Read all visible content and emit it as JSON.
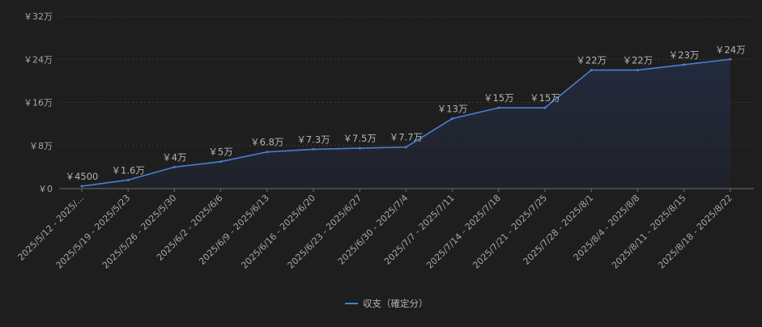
{
  "chart_data": {
    "type": "area",
    "categories": [
      "2025/5/12 - 2025/...",
      "2025/5/19 - 2025/5/23",
      "2025/5/26 - 2025/5/30",
      "2025/6/2 - 2025/6/6",
      "2025/6/9 - 2025/6/13",
      "2025/6/16 - 2025/6/20",
      "2025/6/23 - 2025/6/27",
      "2025/6/30 - 2025/7/4",
      "2025/7/7 - 2025/7/11",
      "2025/7/14 - 2025/7/18",
      "2025/7/21 - 2025/7/25",
      "2025/7/28 - 2025/8/1",
      "2025/8/4 - 2025/8/8",
      "2025/8/11 - 2025/8/15",
      "2025/8/18 - 2025/8/22"
    ],
    "series": [
      {
        "name": "収支（確定分）",
        "values": [
          4500,
          16000,
          40000,
          50000,
          68000,
          73000,
          75000,
          77000,
          130000,
          150000,
          150000,
          220000,
          220000,
          230000,
          240000
        ],
        "labels": [
          "￥4500",
          "￥1.6万",
          "￥4万",
          "￥5万",
          "￥6.8万",
          "￥7.3万",
          "￥7.5万",
          "￥7.7万",
          "￥13万",
          "￥15万",
          "￥15万",
          "￥22万",
          "￥22万",
          "￥23万",
          "￥24万"
        ]
      }
    ],
    "yticks": [
      0,
      80000,
      160000,
      240000,
      320000
    ],
    "ytick_labels": [
      "￥0",
      "￥8万",
      "￥16万",
      "￥24万",
      "￥32万"
    ],
    "ylim": [
      0,
      320000
    ],
    "grid": true,
    "legend_position": "bottom-center",
    "title": "",
    "xlabel": "",
    "ylabel": "",
    "colors": {
      "background": "#1e1e1e",
      "line": "#4a7fd6",
      "area": "#232a3e",
      "grid": "#3a3a3a",
      "axis": "#6b6b6b",
      "text": "#a6a6a6",
      "label": "#b4b4b4"
    }
  }
}
